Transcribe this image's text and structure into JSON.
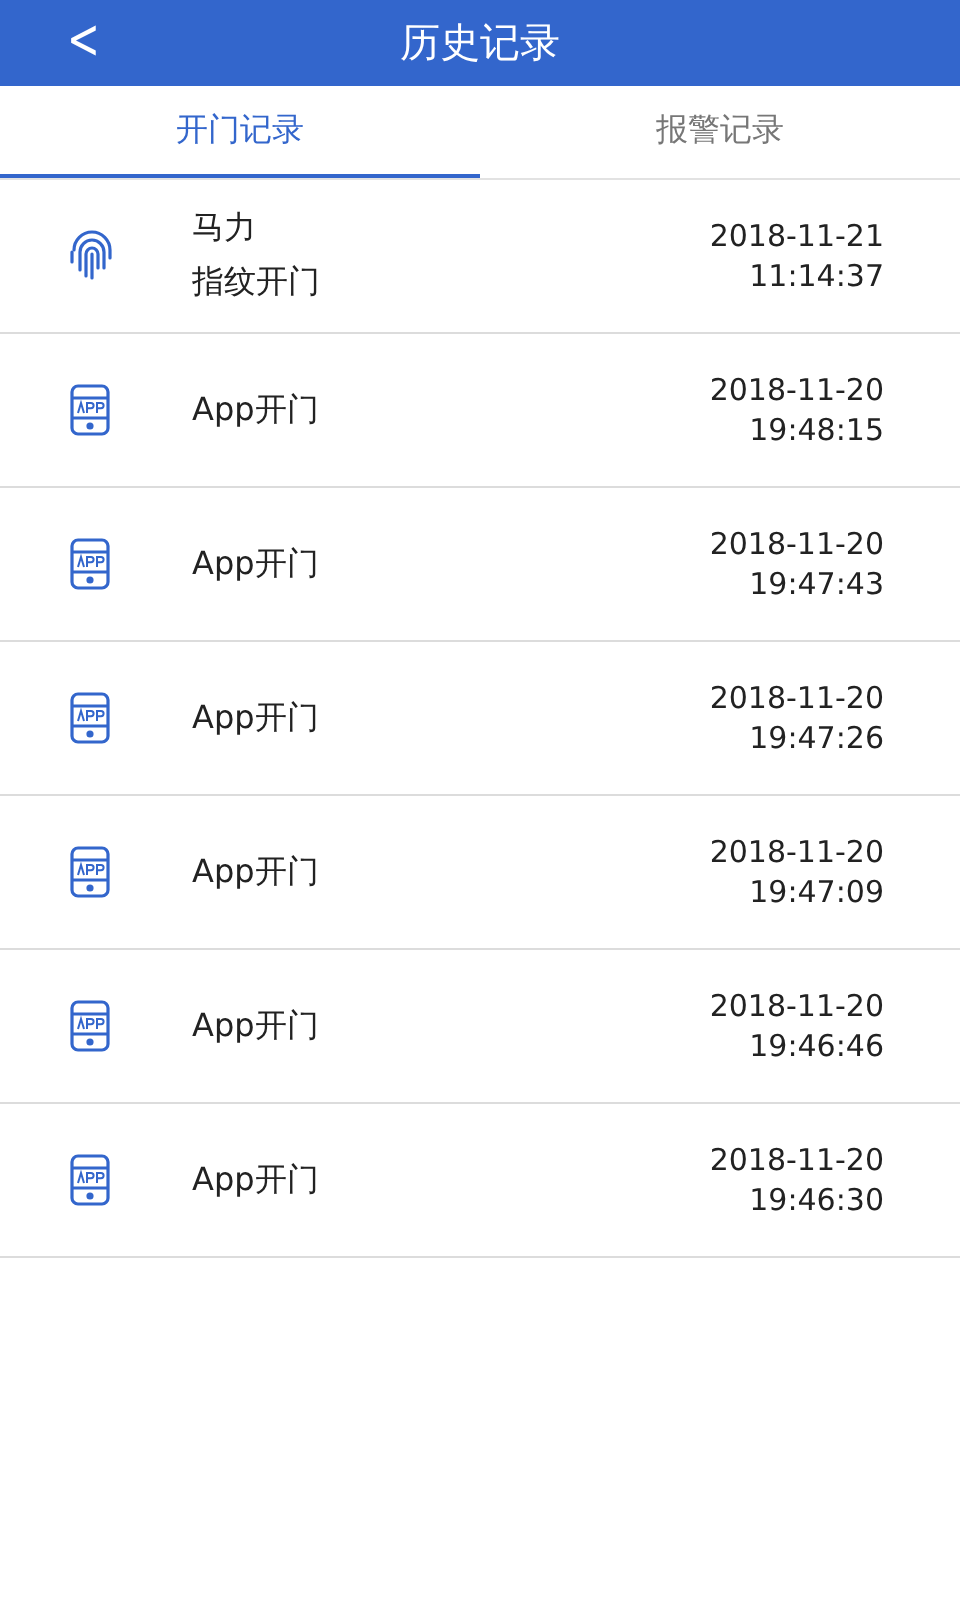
{
  "header": {
    "back": "<",
    "title": "历史记录"
  },
  "tabs": [
    {
      "label": "开门记录",
      "selected": true
    },
    {
      "label": "报警记录",
      "selected": false
    }
  ],
  "records": [
    {
      "kind": "fingerprint",
      "user": "马力",
      "action": "指纹开门",
      "date": "2018-11-21",
      "time": "11:14:37"
    },
    {
      "kind": "app",
      "action": "App开门",
      "date": "2018-11-20",
      "time": "19:48:15"
    },
    {
      "kind": "app",
      "action": "App开门",
      "date": "2018-11-20",
      "time": "19:47:43"
    },
    {
      "kind": "app",
      "action": "App开门",
      "date": "2018-11-20",
      "time": "19:47:26"
    },
    {
      "kind": "app",
      "action": "App开门",
      "date": "2018-11-20",
      "time": "19:47:09"
    },
    {
      "kind": "app",
      "action": "App开门",
      "date": "2018-11-20",
      "time": "19:46:46"
    },
    {
      "kind": "app",
      "action": "App开门",
      "date": "2018-11-20",
      "time": "19:46:30"
    }
  ]
}
